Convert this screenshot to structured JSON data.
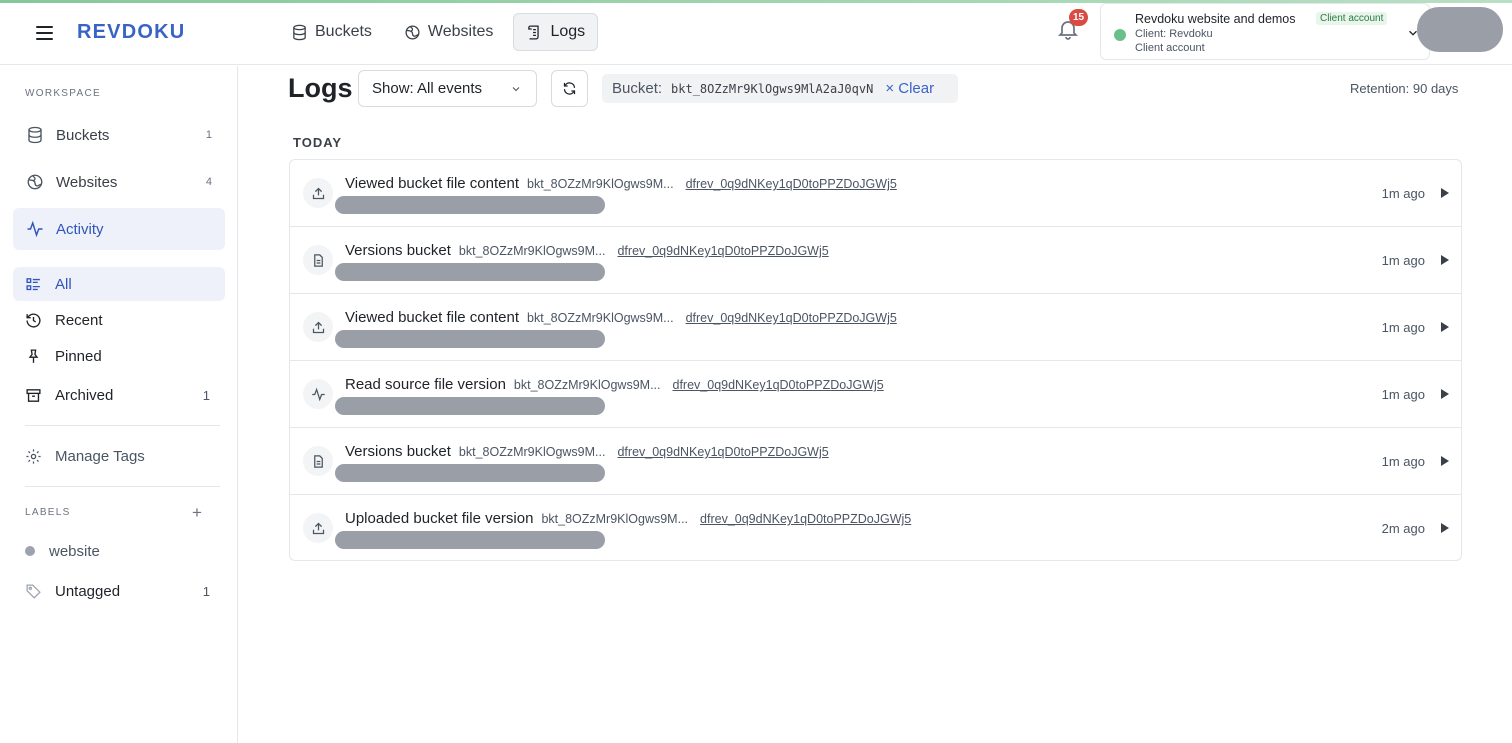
{
  "app": {
    "logo": "REVDOKU"
  },
  "topnav": [
    {
      "label": "Buckets",
      "icon": "database-icon",
      "active": false
    },
    {
      "label": "Websites",
      "icon": "globe-icon",
      "active": false
    },
    {
      "label": "Logs",
      "icon": "logs-icon",
      "active": true
    }
  ],
  "notifications": {
    "count": "15"
  },
  "account": {
    "title": "Revdoku website and demos",
    "badge": "Client account",
    "client": "Client: Revdoku",
    "type": "Client account",
    "status_color": "#6cbf8a"
  },
  "sidebar": {
    "workspace_label": "WORKSPACE",
    "items": [
      {
        "label": "Buckets",
        "count": "1",
        "icon": "database-icon"
      },
      {
        "label": "Websites",
        "count": "4",
        "icon": "globe-icon"
      },
      {
        "label": "Activity",
        "count": "",
        "icon": "activity-icon"
      }
    ],
    "filters": [
      {
        "label": "All",
        "count": "",
        "icon": "list-icon"
      },
      {
        "label": "Recent",
        "count": "",
        "icon": "history-icon"
      },
      {
        "label": "Pinned",
        "count": "",
        "icon": "pin-icon"
      },
      {
        "label": "Archived",
        "count": "1",
        "icon": "archive-icon"
      }
    ],
    "manage_tags": "Manage Tags",
    "labels_label": "LABELS",
    "labels": [
      {
        "label": "website",
        "count": ""
      },
      {
        "label": "Untagged",
        "count": "1"
      }
    ]
  },
  "main": {
    "title": "Logs",
    "show_select": "Show: All events",
    "filter_label": "Bucket:",
    "filter_value": "bkt_8OZzMr9KlOgws9MlA2aJ0qvN",
    "clear_label": "× Clear",
    "retention": "Retention: 90 days",
    "day_label": "TODAY"
  },
  "logs": [
    {
      "title": "Viewed bucket file content",
      "bucket": "bkt_8OZzMr9KlOgws9M...",
      "rev": "dfrev_0q9dNKey1qD0toPPZDoJGWj5",
      "time": "1m ago",
      "icon": "upload-icon"
    },
    {
      "title": "Versions bucket",
      "bucket": "bkt_8OZzMr9KlOgws9M...",
      "rev": "dfrev_0q9dNKey1qD0toPPZDoJGWj5",
      "time": "1m ago",
      "icon": "document-icon"
    },
    {
      "title": "Viewed bucket file content",
      "bucket": "bkt_8OZzMr9KlOgws9M...",
      "rev": "dfrev_0q9dNKey1qD0toPPZDoJGWj5",
      "time": "1m ago",
      "icon": "upload-icon"
    },
    {
      "title": "Read source file version",
      "bucket": "bkt_8OZzMr9KlOgws9M...",
      "rev": "dfrev_0q9dNKey1qD0toPPZDoJGWj5",
      "time": "1m ago",
      "icon": "activity-icon"
    },
    {
      "title": "Versions bucket",
      "bucket": "bkt_8OZzMr9KlOgws9M...",
      "rev": "dfrev_0q9dNKey1qD0toPPZDoJGWj5",
      "time": "1m ago",
      "icon": "document-icon"
    },
    {
      "title": "Uploaded bucket file version",
      "bucket": "bkt_8OZzMr9KlOgws9M...",
      "rev": "dfrev_0q9dNKey1qD0toPPZDoJGWj5",
      "time": "2m ago",
      "icon": "upload-icon"
    }
  ]
}
